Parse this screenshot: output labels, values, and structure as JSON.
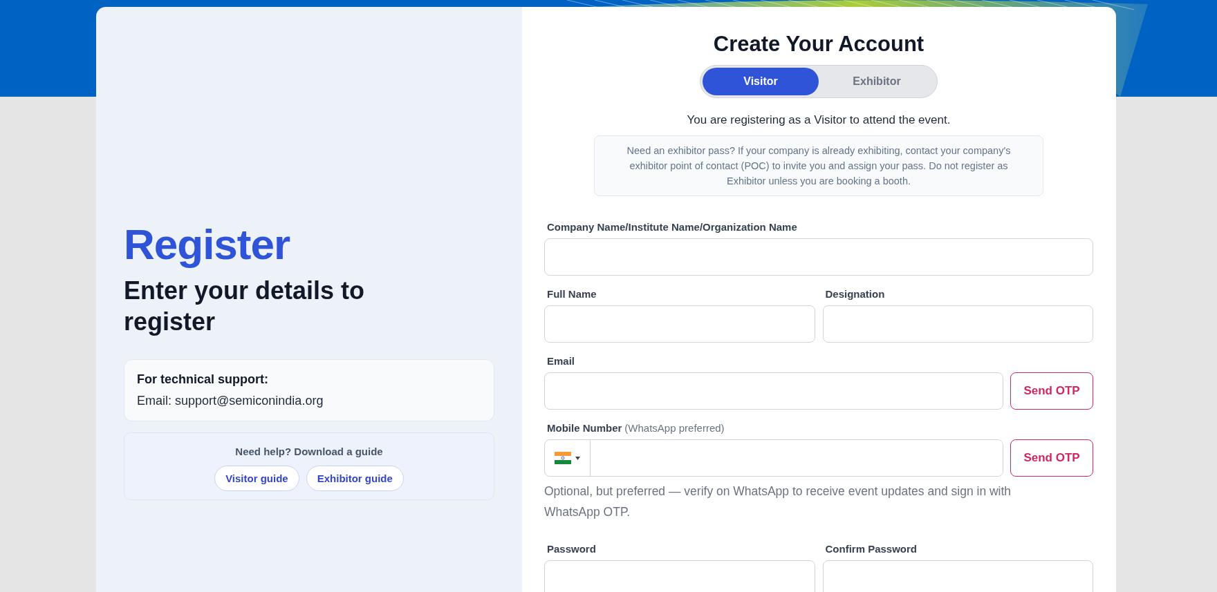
{
  "left": {
    "title": "Register",
    "subtitle": "Enter your details to register",
    "support": {
      "heading": "For technical support:",
      "email_line": "Email: support@semiconindia.org"
    },
    "guides": {
      "heading": "Need help? Download a guide",
      "buttons": [
        "Visitor guide",
        "Exhibitor guide"
      ]
    }
  },
  "form": {
    "title": "Create Your Account",
    "tabs": [
      {
        "label": "Visitor",
        "selected": true
      },
      {
        "label": "Exhibitor",
        "selected": false
      }
    ],
    "intro": "You are registering as a Visitor to attend the event.",
    "notice": "Need an exhibitor pass? If your company is already exhibiting, contact your company's exhibitor point of contact (POC) to invite you and assign your pass. Do not register as Exhibitor unless you are booking a booth.",
    "rows": [
      {
        "fields": [
          {
            "kind": "text",
            "label": "Company Name/Institute Name/Organization Name"
          }
        ]
      },
      {
        "fields": [
          {
            "kind": "text",
            "label": "Full Name"
          },
          {
            "kind": "text",
            "label": "Designation"
          }
        ]
      },
      {
        "fields": [
          {
            "kind": "text",
            "label": "Email",
            "action": "Send OTP"
          }
        ]
      },
      {
        "fields": [
          {
            "kind": "phone",
            "label": "Mobile Number",
            "hint": "(WhatsApp preferred)",
            "action": "Send OTP"
          }
        ],
        "note": "Optional, but preferred — verify on WhatsApp to receive event updates and sign in with WhatsApp OTP."
      },
      {
        "fields": [
          {
            "kind": "password",
            "label": "Password"
          },
          {
            "kind": "password",
            "label": "Confirm Password"
          }
        ]
      }
    ]
  }
}
